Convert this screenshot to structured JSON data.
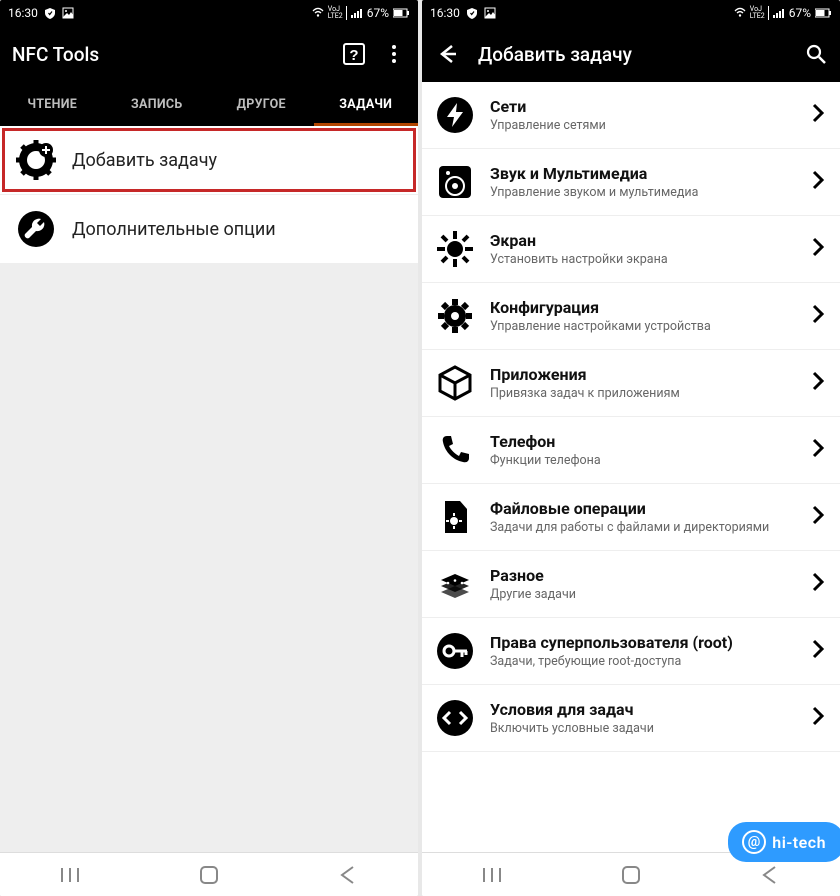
{
  "status": {
    "time": "16:30",
    "battery": "67%"
  },
  "leftScreen": {
    "appTitle": "NFC Tools",
    "tabs": [
      {
        "label": "ЧТЕНИЕ",
        "active": false
      },
      {
        "label": "ЗАПИСЬ",
        "active": false
      },
      {
        "label": "ДРУГОЕ",
        "active": false
      },
      {
        "label": "ЗАДАЧИ",
        "active": true
      }
    ],
    "items": [
      {
        "label": "Добавить задачу",
        "icon": "gear-plus-icon",
        "highlighted": true
      },
      {
        "label": "Дополнительные опции",
        "icon": "wrench-icon",
        "highlighted": false
      }
    ]
  },
  "rightScreen": {
    "appTitle": "Добавить задачу",
    "categories": [
      {
        "title": "Сети",
        "sub": "Управление сетями",
        "icon": "bolt-icon"
      },
      {
        "title": "Звук и Мультимедиа",
        "sub": "Управление звуком и мультимедиа",
        "icon": "speaker-icon"
      },
      {
        "title": "Экран",
        "sub": "Установить настройки экрана",
        "icon": "brightness-icon"
      },
      {
        "title": "Конфигурация",
        "sub": "Управление настройками устройства",
        "icon": "gear-icon"
      },
      {
        "title": "Приложения",
        "sub": "Привязка задач к приложениям",
        "icon": "cube-icon"
      },
      {
        "title": "Телефон",
        "sub": "Функции телефона",
        "icon": "phone-icon"
      },
      {
        "title": "Файловые операции",
        "sub": "Задачи для работы с файлами и директориями",
        "icon": "file-gear-icon"
      },
      {
        "title": "Разное",
        "sub": "Другие задачи",
        "icon": "blocks-icon"
      },
      {
        "title": "Права суперпользователя (root)",
        "sub": "Задачи, требующие root-доступа",
        "icon": "key-icon"
      },
      {
        "title": "Условия для задач",
        "sub": "Включить условные задачи",
        "icon": "code-icon"
      }
    ]
  },
  "watermark": "hi-tech"
}
